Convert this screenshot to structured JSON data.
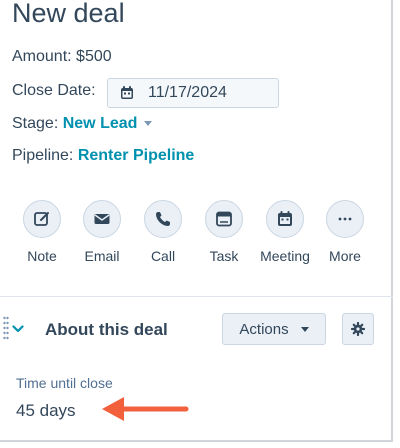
{
  "record": {
    "title": "New deal",
    "amount_label": "Amount:",
    "amount_value": "$500",
    "close_date_label": "Close Date:",
    "close_date_value": "11/17/2024",
    "stage_label": "Stage:",
    "stage_value": "New Lead",
    "pipeline_label": "Pipeline:",
    "pipeline_value": "Renter Pipeline"
  },
  "quick_actions": [
    {
      "label": "Note",
      "icon": "note-icon"
    },
    {
      "label": "Email",
      "icon": "email-icon"
    },
    {
      "label": "Call",
      "icon": "call-icon"
    },
    {
      "label": "Task",
      "icon": "task-icon"
    },
    {
      "label": "Meeting",
      "icon": "meeting-icon"
    },
    {
      "label": "More",
      "icon": "more-icon"
    }
  ],
  "about_section": {
    "title": "About this deal",
    "actions_label": "Actions",
    "property_label": "Time until close",
    "property_value": "45 days"
  },
  "colors": {
    "link": "#0091ae",
    "text": "#33475b",
    "arrow": "#f2603c"
  }
}
